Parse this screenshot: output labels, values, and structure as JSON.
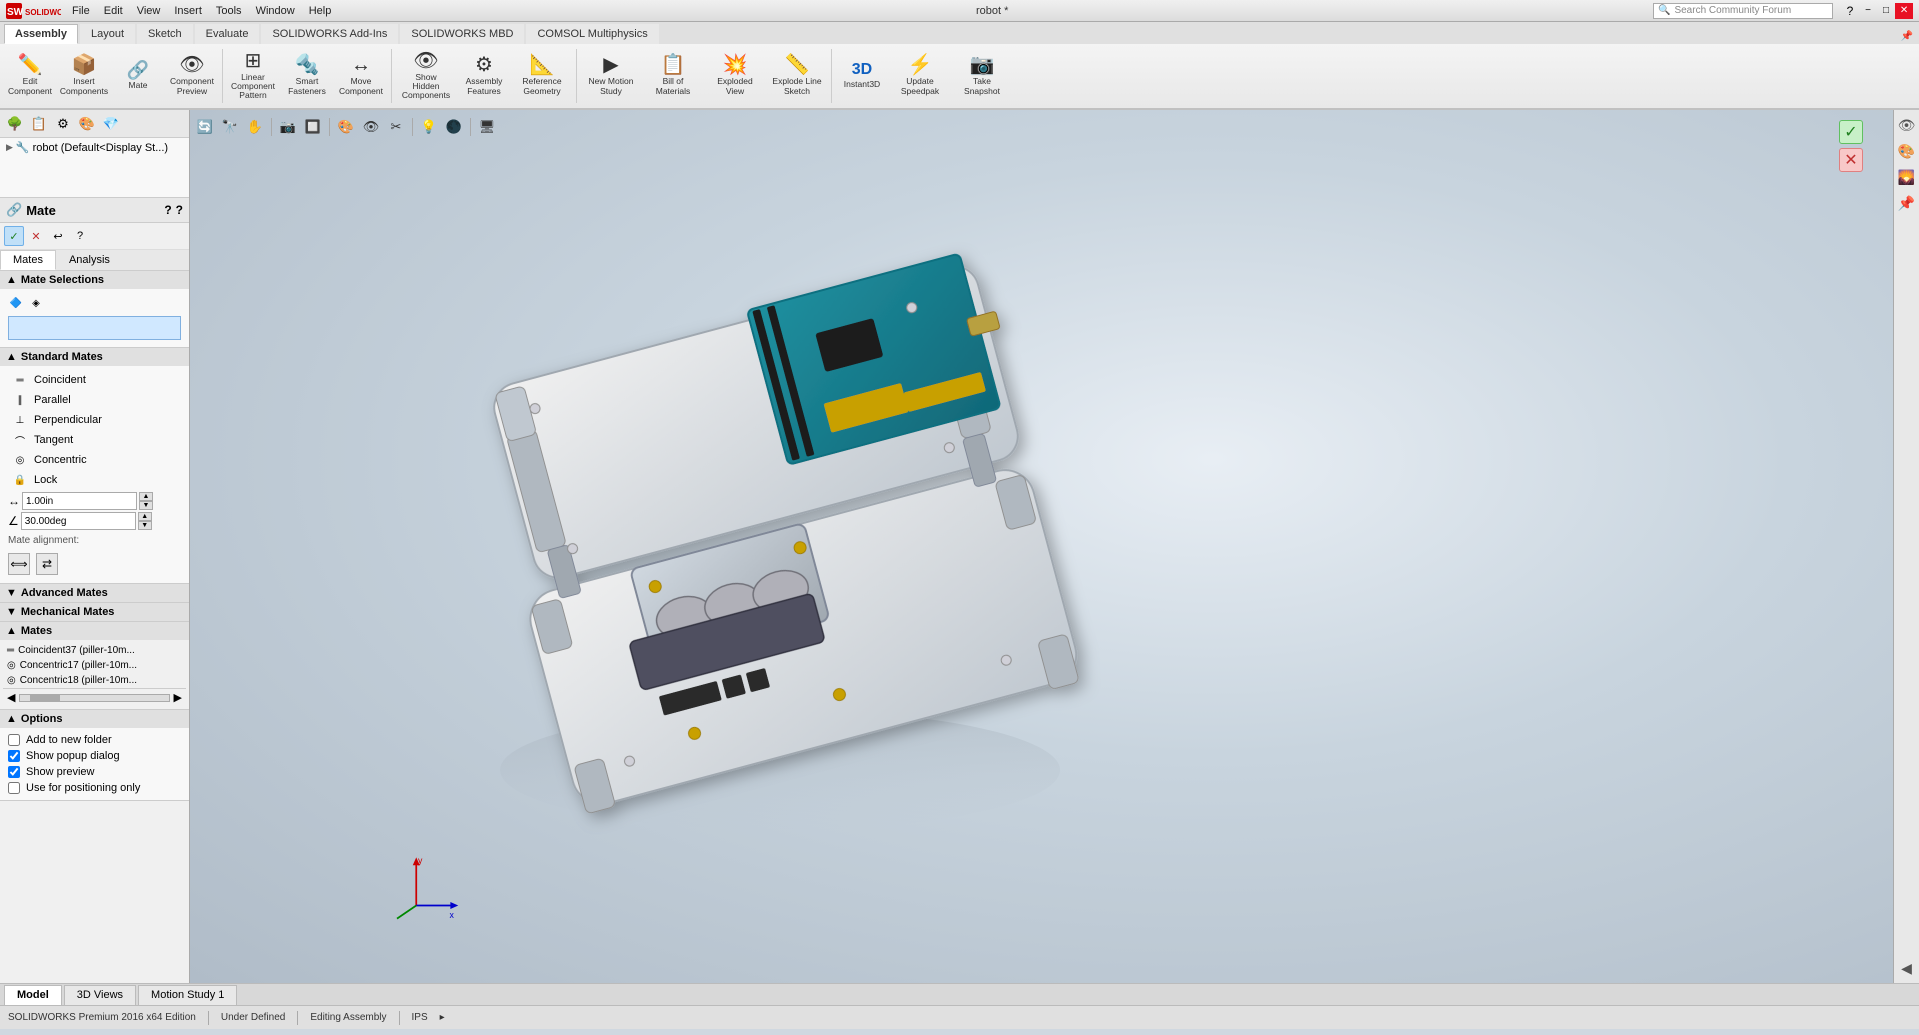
{
  "titlebar": {
    "title": "robot *",
    "search_placeholder": "Search Community Forum",
    "menus": [
      "File",
      "Edit",
      "View",
      "Insert",
      "Tools",
      "Window",
      "Help"
    ],
    "logo_text": "SOLIDWORKS"
  },
  "ribbon": {
    "tabs": [
      "Assembly",
      "Layout",
      "Sketch",
      "Evaluate",
      "SOLIDWORKS Add-Ins",
      "SOLIDWORKS MBD",
      "COMSOL Multiphysics"
    ],
    "active_tab": "Assembly",
    "buttons": [
      {
        "id": "edit-component",
        "label": "Edit Component",
        "icon": "✏️"
      },
      {
        "id": "insert-components",
        "label": "Insert Components",
        "icon": "📦"
      },
      {
        "id": "mate",
        "label": "Mate",
        "icon": "🔗"
      },
      {
        "id": "component-preview",
        "label": "Component Preview",
        "icon": "👁"
      },
      {
        "id": "linear-pattern",
        "label": "Linear Component Pattern",
        "icon": "⊞"
      },
      {
        "id": "smart-fasteners",
        "label": "Smart Fasteners",
        "icon": "🔩"
      },
      {
        "id": "move-component",
        "label": "Move Component",
        "icon": "↔"
      },
      {
        "id": "show-hidden",
        "label": "Show Hidden Components",
        "icon": "👁"
      },
      {
        "id": "assembly-features",
        "label": "Assembly Features",
        "icon": "⚙"
      },
      {
        "id": "reference-geometry",
        "label": "Reference Geometry",
        "icon": "📐"
      },
      {
        "id": "new-motion",
        "label": "New Motion Study",
        "icon": "▶"
      },
      {
        "id": "bill-of-materials",
        "label": "Bill of Materials",
        "icon": "📋"
      },
      {
        "id": "exploded-view",
        "label": "Exploded View",
        "icon": "💥"
      },
      {
        "id": "explode-line",
        "label": "Explode Line Sketch",
        "icon": "📏"
      },
      {
        "id": "instant3d",
        "label": "Instant3D",
        "icon": "3"
      },
      {
        "id": "update-speedpak",
        "label": "Update Speedpak",
        "icon": "⚡"
      },
      {
        "id": "snapshot",
        "label": "Take Snapshot",
        "icon": "📷"
      }
    ]
  },
  "viewport_toolbar": {
    "buttons": [
      "🔄",
      "📷",
      "🔭",
      "🔲",
      "📐",
      "📦",
      "👁",
      "🎨",
      "🔮",
      "🖥"
    ]
  },
  "left_panel": {
    "title": "Mate",
    "tabs": [
      "Mates",
      "Analysis"
    ],
    "active_tab": "Mates",
    "mate_selections_label": "Mate Selections",
    "standard_mates_label": "Standard Mates",
    "standard_mates": [
      {
        "label": "Coincident",
        "icon": "═"
      },
      {
        "label": "Parallel",
        "icon": "∥"
      },
      {
        "label": "Perpendicular",
        "icon": "⊥"
      },
      {
        "label": "Tangent",
        "icon": "⌒"
      },
      {
        "label": "Concentric",
        "icon": "◎"
      },
      {
        "label": "Lock",
        "icon": "🔒"
      }
    ],
    "distance_value": "1.00in",
    "angle_value": "30.00deg",
    "mate_alignment_label": "Mate alignment:",
    "advanced_mates_label": "Advanced Mates",
    "mechanical_mates_label": "Mechanical Mates",
    "mates_label": "Mates",
    "mates_list": [
      {
        "label": "Coincident37 (piller-10m...",
        "icon": "═"
      },
      {
        "label": "Concentric17 (piller-10m...",
        "icon": "◎"
      },
      {
        "label": "Concentric18 (piller-10m...",
        "icon": "◎"
      }
    ],
    "options_label": "Options",
    "options": [
      {
        "label": "Add to new folder",
        "checked": false
      },
      {
        "label": "Show popup dialog",
        "checked": true
      },
      {
        "label": "Show preview",
        "checked": true
      },
      {
        "label": "Use for positioning only",
        "checked": false
      }
    ]
  },
  "feature_tree": {
    "items": [
      {
        "label": "robot (Default<Display St...)",
        "icon": "🔧",
        "indent": 0
      }
    ]
  },
  "bottom_tabs": [
    "Model",
    "3D Views",
    "Motion Study 1"
  ],
  "active_bottom_tab": "Model",
  "statusbar": {
    "left": "SOLIDWORKS Premium 2016 x64 Edition",
    "status": "Under Defined",
    "editing": "Editing Assembly",
    "units": "IPS",
    "extras": "▸"
  },
  "axes": {
    "x_label": "x",
    "y_label": "y"
  }
}
